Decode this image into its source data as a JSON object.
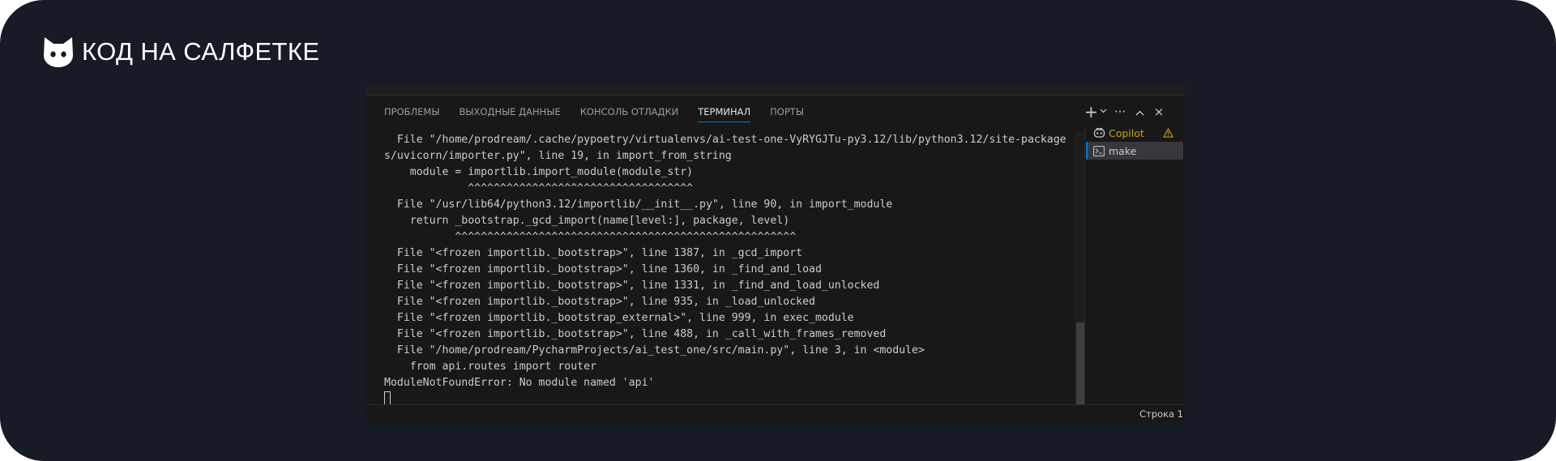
{
  "brand": {
    "name": "КОД НА САЛФЕТКЕ",
    "logo_icon": "cat-head-icon"
  },
  "tabs": [
    {
      "label": "ПРОБЛЕМЫ"
    },
    {
      "label": "ВЫХОДНЫЕ ДАННЫЕ"
    },
    {
      "label": "КОНСОЛЬ ОТЛАДКИ"
    },
    {
      "label": "ТЕРМИНАЛ",
      "active": true
    },
    {
      "label": "ПОРТЫ"
    }
  ],
  "actions": {
    "new_terminal": "+",
    "dropdown": "⌄",
    "more": "···",
    "maximize": "^",
    "close": "×"
  },
  "terminal": {
    "lines": [
      "  File \"/home/prodream/.cache/pypoetry/virtualenvs/ai-test-one-VyRYGJTu-py3.12/lib/python3.12/site-package",
      "s/uvicorn/importer.py\", line 19, in import_from_string",
      "    module = importlib.import_module(module_str)",
      "             ^^^^^^^^^^^^^^^^^^^^^^^^^^^^^^^^^^^",
      "  File \"/usr/lib64/python3.12/importlib/__init__.py\", line 90, in import_module",
      "    return _bootstrap._gcd_import(name[level:], package, level)",
      "           ^^^^^^^^^^^^^^^^^^^^^^^^^^^^^^^^^^^^^^^^^^^^^^^^^^^^^",
      "  File \"<frozen importlib._bootstrap>\", line 1387, in _gcd_import",
      "  File \"<frozen importlib._bootstrap>\", line 1360, in _find_and_load",
      "  File \"<frozen importlib._bootstrap>\", line 1331, in _find_and_load_unlocked",
      "  File \"<frozen importlib._bootstrap>\", line 935, in _load_unlocked",
      "  File \"<frozen importlib._bootstrap_external>\", line 999, in exec_module",
      "  File \"<frozen importlib._bootstrap>\", line 488, in _call_with_frames_removed",
      "  File \"/home/prodream/PycharmProjects/ai_test_one/src/main.py\", line 3, in <module>",
      "    from api.routes import router",
      "ModuleNotFoundError: No module named 'api'"
    ]
  },
  "sidebar": {
    "items": [
      {
        "label": "Copilot",
        "icon": "copilot-icon",
        "status_icon": "warning-icon"
      },
      {
        "label": "make",
        "icon": "terminal-icon",
        "active": true
      }
    ]
  },
  "status": {
    "line_indicator": "Строка 1"
  }
}
